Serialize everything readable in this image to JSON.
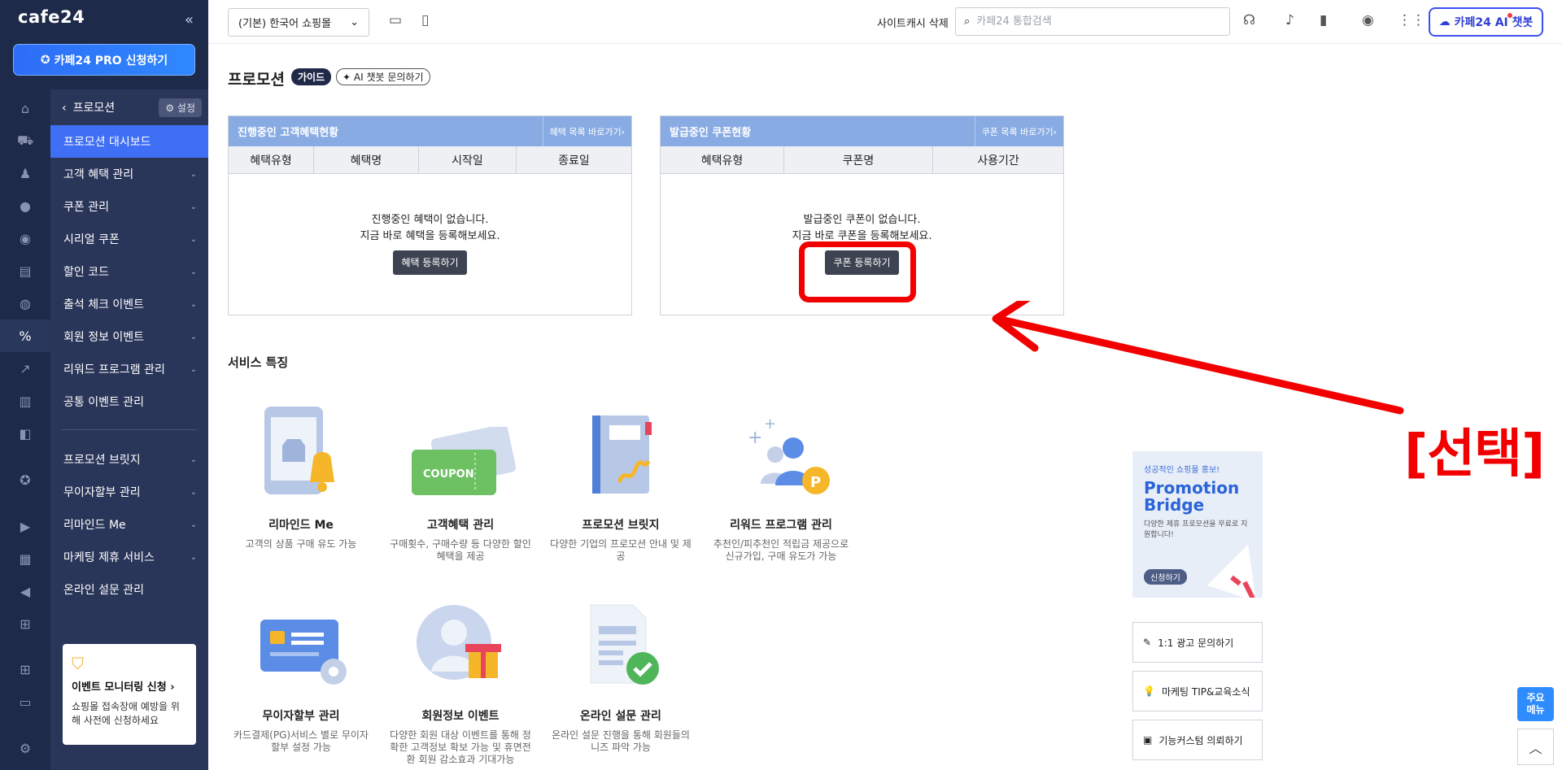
{
  "app": {
    "logo": "cafe24",
    "pro_button": "카페24 PRO 신청하기"
  },
  "sidebar": {
    "back_label": "프로모션",
    "setting_label": "설정",
    "items": [
      {
        "label": "프로모션 대시보드",
        "active": true,
        "caret": ""
      },
      {
        "label": "고객 혜택 관리",
        "caret": "⌄"
      },
      {
        "label": "쿠폰 관리",
        "caret": "⌄"
      },
      {
        "label": "시리얼 쿠폰",
        "caret": "⌄"
      },
      {
        "label": "할인 코드",
        "caret": "⌄"
      },
      {
        "label": "출석 체크 이벤트",
        "caret": "⌄"
      },
      {
        "label": "회원 정보 이벤트",
        "caret": "⌄"
      },
      {
        "label": "리워드 프로그램 관리",
        "caret": "⌄"
      },
      {
        "label": "공통 이벤트 관리",
        "caret": ""
      }
    ],
    "items2": [
      {
        "label": "프로모션 브릿지",
        "caret": "⌄"
      },
      {
        "label": "무이자할부 관리",
        "caret": "⌄"
      },
      {
        "label": "리마인드 Me",
        "caret": "⌄"
      },
      {
        "label": "마케팅 제휴 서비스",
        "caret": "⌄"
      },
      {
        "label": "온라인 설문 관리",
        "caret": ""
      }
    ],
    "monitor_card": {
      "title": "이벤트 모니터링 신청",
      "desc": "쇼핑몰 접속장애 예방을 위해 사전에 신청하세요"
    }
  },
  "topbar": {
    "shop_select": "(기본) 한국어 쇼핑몰",
    "cache_delete": "사이트캐시 삭제",
    "search_placeholder": "카페24 통합검색",
    "ai_chatbot": "카페24 AI 챗봇"
  },
  "page": {
    "title": "프로모션",
    "guide_badge": "가이드",
    "ai_chat_link": "AI 챗봇 문의하기"
  },
  "benefit_panel": {
    "title": "진행중인 고객혜택현황",
    "link": "혜택 목록 바로가기›",
    "columns": [
      "혜택유형",
      "혜택명",
      "시작일",
      "종료일"
    ],
    "empty_line1": "진행중인 혜택이 없습니다.",
    "empty_line2": "지금 바로 혜택을 등록해보세요.",
    "button": "혜택 등록하기"
  },
  "coupon_panel": {
    "title": "발급중인 쿠폰현황",
    "link": "쿠폰 목록 바로가기›",
    "columns": [
      "혜택유형",
      "쿠폰명",
      "사용기간"
    ],
    "empty_line1": "발급중인 쿠폰이 없습니다.",
    "empty_line2": "지금 바로 쿠폰을 등록해보세요.",
    "button": "쿠폰 등록하기"
  },
  "annotation": {
    "label": "[선택]",
    "color": "#f20000"
  },
  "services": {
    "title": "서비스 특징",
    "items": [
      {
        "name": "리마인드 Me",
        "desc": "고객의 상품 구매 유도 가능",
        "icon": "tablet-bell-icon"
      },
      {
        "name": "고객혜택 관리",
        "desc": "구매횟수, 구매수량 등 다양한 할인 혜택을 제공",
        "icon": "coupon-icon"
      },
      {
        "name": "프로모션 브릿지",
        "desc": "다양한 기업의 프로모션 안내 및 제공",
        "icon": "notebook-icon"
      },
      {
        "name": "리워드 프로그램 관리",
        "desc": "추천인/피추천인 적립금 제공으로 신규가입, 구매 유도가 가능",
        "icon": "people-point-icon"
      },
      {
        "name": "무이자할부 관리",
        "desc": "카드결제(PG)서비스 별로 무이자 할부 설정 가능",
        "icon": "card-gear-icon"
      },
      {
        "name": "회원정보 이벤트",
        "desc": "다양한 회원 대상 이벤트를 통해 정확한 고객정보 확보 가능 및 휴면전환 회원 감소효과 기대가능",
        "icon": "member-gift-icon"
      },
      {
        "name": "온라인 설문 관리",
        "desc": "온라인 설문 진행을 통해 회원들의 니즈 파악 가능",
        "icon": "survey-check-icon"
      }
    ]
  },
  "promo_card": {
    "tag": "성공적인 쇼핑몰 홍보!",
    "title_line1": "Promotion",
    "title_line2": "Bridge",
    "desc": "다양한 제휴 프로모션을 무료로 지원합니다!",
    "apply": "신청하기"
  },
  "side_buttons": [
    {
      "label": "1:1 광고 문의하기",
      "icon": "edit-icon"
    },
    {
      "label": "마케팅 TIP&교육소식",
      "icon": "bulb-icon"
    },
    {
      "label": "기능커스텀 의뢰하기",
      "icon": "custom-icon"
    }
  ],
  "floating": {
    "main_menu": "주요\n메뉴"
  },
  "colors": {
    "sidebar_bg": "#2a3659",
    "rail_bg": "#1e2a4a",
    "accent": "#3e6ff4",
    "panel_header": "#89abe3"
  }
}
